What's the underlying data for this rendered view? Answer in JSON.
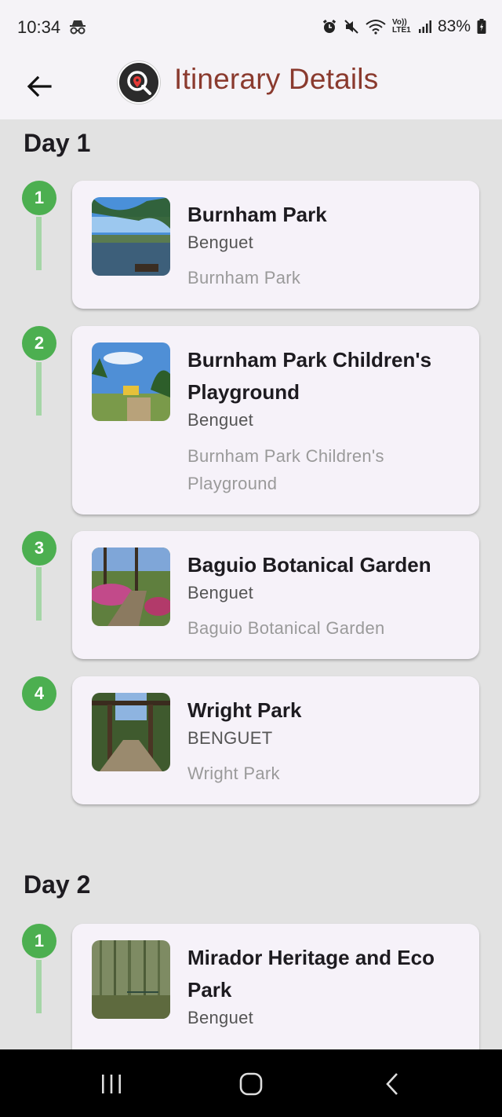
{
  "status_bar": {
    "time": "10:34",
    "battery": "83%",
    "network": "Vo)) LTE1"
  },
  "app_bar": {
    "title": "Itinerary Details"
  },
  "days": [
    {
      "label": "Day 1",
      "stops": [
        {
          "number": "1",
          "title": "Burnham Park",
          "province": "Benguet",
          "subtitle": "Burnham Park"
        },
        {
          "number": "2",
          "title": "Burnham Park Children's Playground",
          "province": "Benguet",
          "subtitle": "Burnham Park Children's Playground"
        },
        {
          "number": "3",
          "title": "Baguio Botanical Garden",
          "province": "Benguet",
          "subtitle": "Baguio Botanical Garden"
        },
        {
          "number": "4",
          "title": "Wright Park",
          "province": "BENGUET",
          "subtitle": "Wright Park"
        }
      ]
    },
    {
      "label": "Day 2",
      "stops": [
        {
          "number": "1",
          "title": "Mirador Heritage and Eco Park",
          "province": "Benguet",
          "subtitle": ""
        }
      ]
    }
  ],
  "colors": {
    "accent_title": "#8a3a2e",
    "timeline_node": "#4caf50",
    "timeline_line": "#a5d6a7",
    "card_bg": "#f6f2f9"
  }
}
